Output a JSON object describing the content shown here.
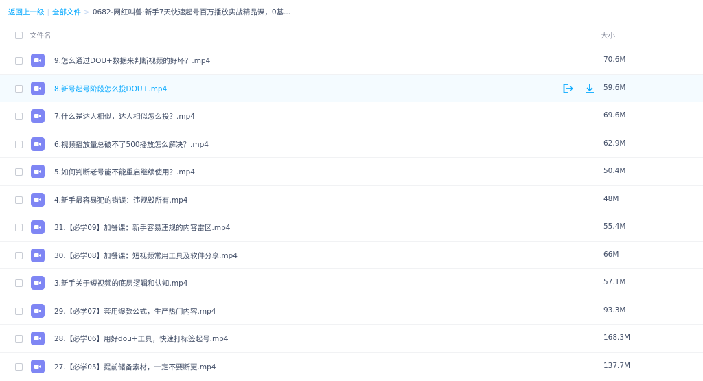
{
  "breadcrumb": {
    "back": "返回上一级",
    "separator": "|",
    "all_files": "全部文件",
    "arrow": ">",
    "current": "0682-网红叫兽·新手7天快速起号百万播放实战精品课，0基..."
  },
  "table": {
    "col_name": "文件名",
    "col_size": "大小",
    "file_icon": "video-file-icon",
    "accent_color": "#09aaff",
    "icon_color": "#7f86f4",
    "rows": [
      {
        "name": "9.怎么通过DOU+数据来判断视频的好坏？.mp4",
        "size": "70.6M"
      },
      {
        "name": "8.新号起号阶段怎么投DOU+.mp4",
        "size": "59.6M",
        "hovered": true,
        "actions": [
          "share-icon",
          "download-icon"
        ]
      },
      {
        "name": "7.什么是达人相似，达人相似怎么投？.mp4",
        "size": "69.6M"
      },
      {
        "name": "6.视频播放量总破不了500播放怎么解决？.mp4",
        "size": "62.9M"
      },
      {
        "name": "5.如何判断老号能不能重启继续使用？.mp4",
        "size": "50.4M"
      },
      {
        "name": "4.新手最容易犯的错误：违规毁所有.mp4",
        "size": "48M"
      },
      {
        "name": "31.【必学09】加餐课：新手容易违规的内容雷区.mp4",
        "size": "55.4M"
      },
      {
        "name": "30.【必学08】加餐课：短视频常用工具及软件分享.mp4",
        "size": "66M"
      },
      {
        "name": "3.新手关于短视频的底层逻辑和认知.mp4",
        "size": "57.1M"
      },
      {
        "name": "29.【必学07】套用爆款公式，生产热门内容.mp4",
        "size": "93.3M"
      },
      {
        "name": "28.【必学06】用好dou+工具，快速打标签起号.mp4",
        "size": "168.3M"
      },
      {
        "name": "27.【必学05】提前储备素材，一定不要断更.mp4",
        "size": "137.7M"
      }
    ]
  }
}
